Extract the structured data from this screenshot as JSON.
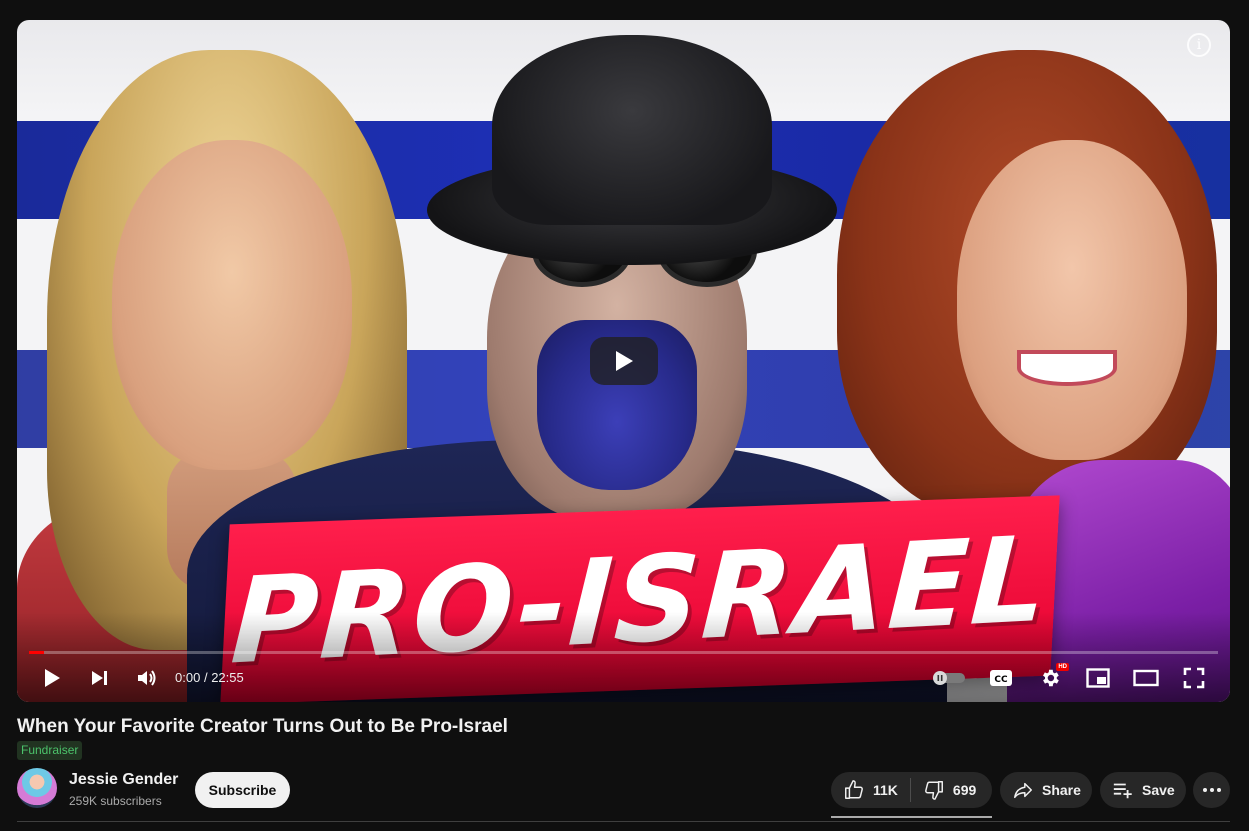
{
  "player": {
    "thumbnail_text": "PRO-ISRAEL",
    "time_current": "0:00",
    "time_separator": "/",
    "time_total": "22:55",
    "progress_played_fraction": 0.013,
    "hd_badge": "HD",
    "icons": {
      "info": "info-icon",
      "big_play": "play-icon",
      "play": "play-icon",
      "next": "next-icon",
      "volume": "volume-icon",
      "autoplay": "autoplay-toggle-icon",
      "captions": "cc-icon",
      "settings": "gear-icon",
      "miniplayer": "miniplayer-icon",
      "theater": "theater-icon",
      "fullscreen": "fullscreen-icon"
    }
  },
  "video": {
    "title": "When Your Favorite Creator Turns Out to Be Pro-Israel",
    "badge": "Fundraiser"
  },
  "channel": {
    "name": "Jessie Gender",
    "subscribers": "259K subscribers",
    "subscribe_label": "Subscribe"
  },
  "actions": {
    "likes": "11K",
    "dislikes": "699",
    "share_label": "Share",
    "save_label": "Save"
  },
  "colors": {
    "background": "#0f0f0f",
    "accent_red": "#ff0000",
    "banner_red": "#ff1f4c",
    "flag_blue": "#1d2fb4",
    "fundraiser_green": "#4cc26b"
  }
}
